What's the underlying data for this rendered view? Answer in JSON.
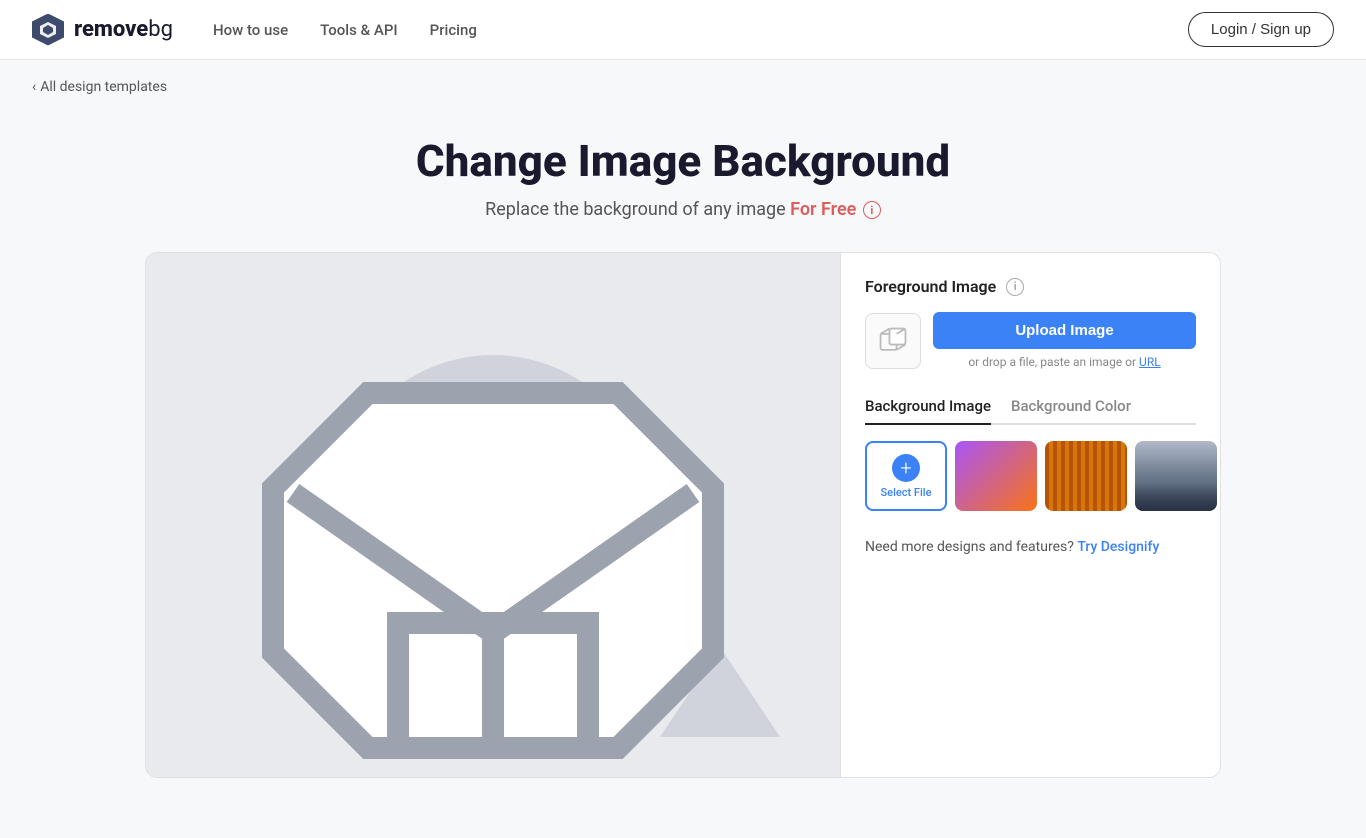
{
  "nav": {
    "logo_text_bold": "remove",
    "logo_text_light": "bg",
    "links": [
      {
        "label": "How to use",
        "href": "#"
      },
      {
        "label": "Tools & API",
        "href": "#"
      },
      {
        "label": "Pricing",
        "href": "#"
      }
    ],
    "login_label": "Login / Sign up"
  },
  "breadcrumb": {
    "label": "All design templates",
    "href": "#"
  },
  "hero": {
    "title": "Change Image Background",
    "subtitle": "Replace the background of any image",
    "for_free_label": "For Free"
  },
  "foreground": {
    "section_title": "Foreground Image",
    "upload_button_label": "Upload Image",
    "upload_hint": "or drop a file, paste an image or",
    "upload_hint_url": "URL"
  },
  "background": {
    "tab_image_label": "Background Image",
    "tab_color_label": "Background Color",
    "select_file_label": "Select File",
    "next_icon": "›"
  },
  "designify": {
    "hint": "Need more designs and features?",
    "link_label": "Try Designify"
  }
}
